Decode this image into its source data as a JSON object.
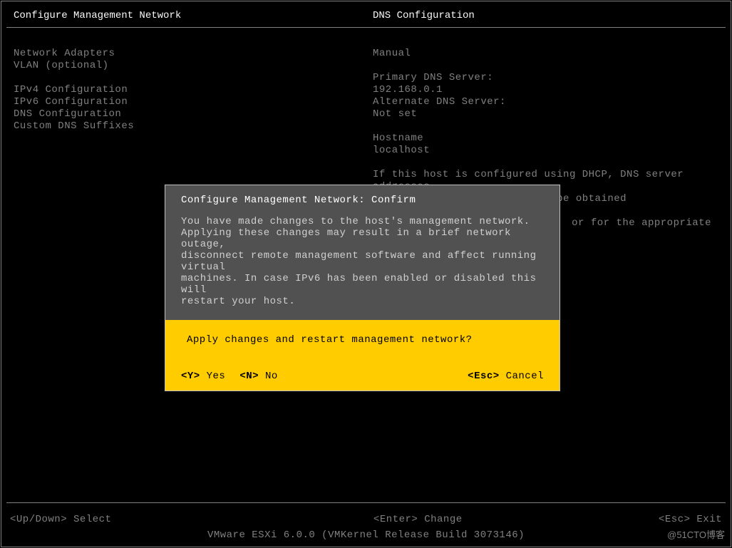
{
  "header": {
    "left_title": "Configure Management Network",
    "right_title": "DNS Configuration"
  },
  "menu": {
    "items": [
      "Network Adapters",
      "VLAN (optional)",
      "",
      "IPv4 Configuration",
      "IPv6 Configuration",
      "DNS Configuration",
      "Custom DNS Suffixes"
    ]
  },
  "info": {
    "mode": "Manual",
    "primary_label": "Primary DNS Server:",
    "primary_value": "192.168.0.1",
    "alternate_label": "Alternate DNS Server:",
    "alternate_value": "Not set",
    "hostname_label": "Hostname",
    "hostname_value": "localhost",
    "help1": "If this host is configured using DHCP, DNS server addresses",
    "help2": "and other DNS parameters can be obtained automatically. If",
    "help3": "or for the appropriate"
  },
  "dialog": {
    "title": "Configure Management Network: Confirm",
    "body": "You have made changes to the host's management network.\nApplying these changes may result in a brief network outage,\ndisconnect remote management software and affect running virtual\nmachines. In case IPv6 has been enabled or disabled this will\nrestart your host.",
    "prompt": "Apply changes and restart management network?",
    "yes_key": "<Y>",
    "yes_label": " Yes",
    "no_key": "<N>",
    "no_label": " No",
    "cancel_key": "<Esc>",
    "cancel_label": " Cancel"
  },
  "footer": {
    "left": "<Up/Down> Select",
    "center": "<Enter> Change",
    "right": "<Esc> Exit"
  },
  "version": "VMware ESXi 6.0.0 (VMKernel Release Build 3073146)",
  "watermark": "@51CTO博客"
}
